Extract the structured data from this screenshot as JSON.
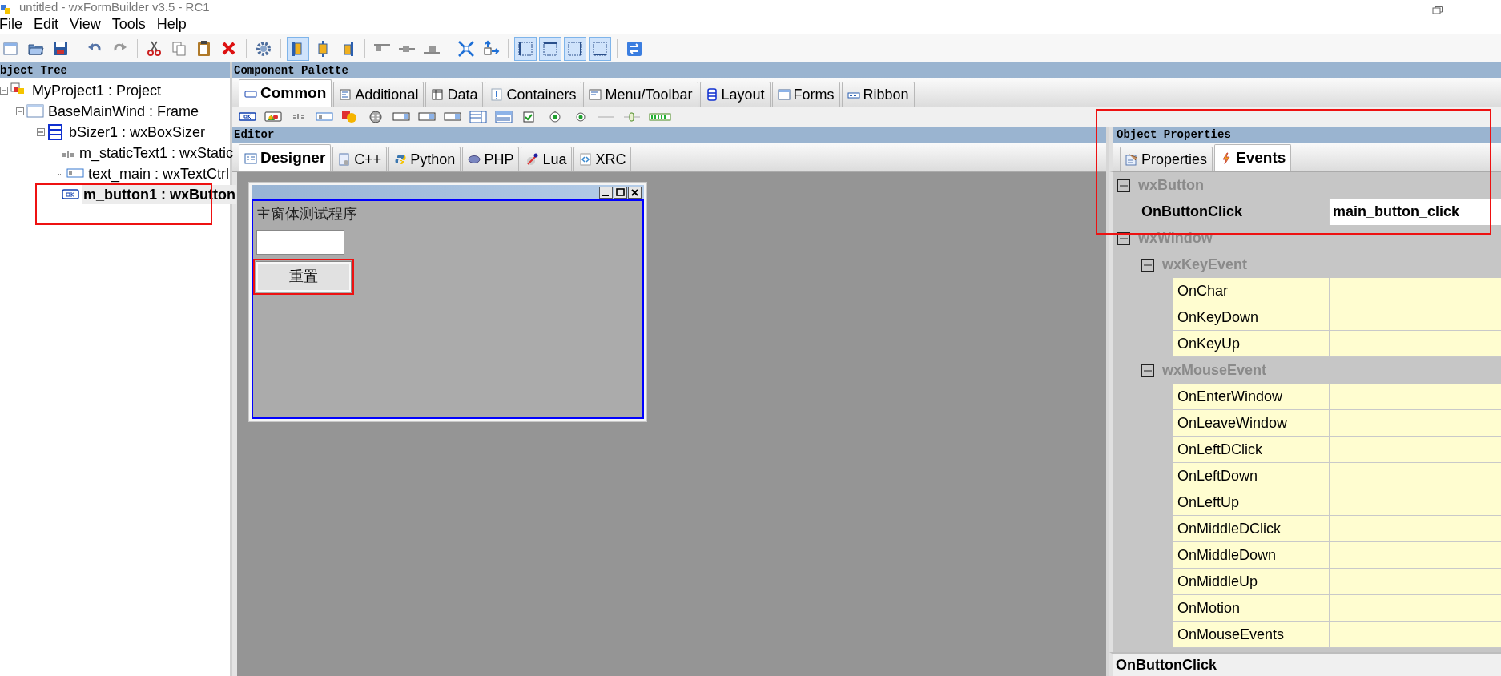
{
  "window": {
    "title": "untitled - wxFormBuilder v3.5 - RC1"
  },
  "menu": [
    "File",
    "Edit",
    "View",
    "Tools",
    "Help"
  ],
  "toolbar": [
    {
      "kind": "new",
      "pressed": false
    },
    {
      "kind": "open",
      "pressed": false
    },
    {
      "kind": "save",
      "pressed": false
    },
    {
      "kind": "separator"
    },
    {
      "kind": "undo",
      "pressed": false
    },
    {
      "kind": "redo",
      "pressed": false
    },
    {
      "kind": "separator"
    },
    {
      "kind": "cut",
      "pressed": false
    },
    {
      "kind": "copy",
      "pressed": false
    },
    {
      "kind": "paste",
      "pressed": false
    },
    {
      "kind": "delete",
      "pressed": false
    },
    {
      "kind": "separator"
    },
    {
      "kind": "settings",
      "pressed": false
    },
    {
      "kind": "separator"
    },
    {
      "kind": "align-left",
      "pressed": true
    },
    {
      "kind": "align-center",
      "pressed": false
    },
    {
      "kind": "align-right",
      "pressed": false
    },
    {
      "kind": "separator"
    },
    {
      "kind": "align-top",
      "pressed": false
    },
    {
      "kind": "align-middle",
      "pressed": false
    },
    {
      "kind": "align-bottom",
      "pressed": false
    },
    {
      "kind": "separator"
    },
    {
      "kind": "expand",
      "pressed": false
    },
    {
      "kind": "stretch",
      "pressed": false
    },
    {
      "kind": "separator"
    },
    {
      "kind": "border-left",
      "pressed": true
    },
    {
      "kind": "border-top",
      "pressed": true
    },
    {
      "kind": "border-right",
      "pressed": true
    },
    {
      "kind": "border-bottom",
      "pressed": true
    },
    {
      "kind": "separator"
    },
    {
      "kind": "swap",
      "pressed": false
    }
  ],
  "object_tree": {
    "title": "bject Tree",
    "items": [
      {
        "label": "MyProject1 : Project",
        "kind": "project",
        "selected": false,
        "expanded": true,
        "children": [
          {
            "label": "BaseMainWind : Frame",
            "kind": "frame",
            "selected": false,
            "expanded": true,
            "children": [
              {
                "label": "bSizer1 : wxBoxSizer",
                "kind": "sizer",
                "selected": false,
                "expanded": true,
                "children": [
                  {
                    "label": "m_staticText1 : wxStatic",
                    "kind": "statictext",
                    "selected": false,
                    "highlighted": false
                  },
                  {
                    "label": "text_main : wxTextCtrl",
                    "kind": "textctrl",
                    "selected": false,
                    "highlighted": false
                  },
                  {
                    "label": "m_button1 : wxButton",
                    "kind": "button",
                    "selected": true,
                    "highlighted": true
                  }
                ]
              }
            ]
          }
        ]
      }
    ]
  },
  "palette": {
    "title": "Component Palette",
    "tabs": [
      {
        "label": "Common",
        "selected": true
      },
      {
        "label": "Additional",
        "selected": false
      },
      {
        "label": "Data",
        "selected": false
      },
      {
        "label": "Containers",
        "selected": false
      },
      {
        "label": "Menu/Toolbar",
        "selected": false
      },
      {
        "label": "Layout",
        "selected": false
      },
      {
        "label": "Forms",
        "selected": false
      },
      {
        "label": "Ribbon",
        "selected": false
      }
    ]
  },
  "editor": {
    "title": "Editor",
    "tabs": [
      {
        "label": "Designer",
        "selected": true
      },
      {
        "label": "C++",
        "selected": false
      },
      {
        "label": "Python",
        "selected": false
      },
      {
        "label": "PHP",
        "selected": false
      },
      {
        "label": "Lua",
        "selected": false
      },
      {
        "label": "XRC",
        "selected": false
      }
    ],
    "form": {
      "static_text": "主窗体测试程序",
      "button": {
        "label": "重置",
        "highlighted": true
      }
    }
  },
  "properties": {
    "title": "Object Properties",
    "highlighted": true,
    "tabs": [
      {
        "label": "Properties",
        "selected": false
      },
      {
        "label": "Events",
        "selected": true
      }
    ],
    "groups": [
      {
        "name": "wxButton",
        "expanded": true,
        "rows": [
          {
            "name": "OnButtonClick",
            "value": "main_button_click",
            "modified": true
          }
        ]
      },
      {
        "name": "wxWindow",
        "expanded": true,
        "groups": [
          {
            "name": "wxKeyEvent",
            "expanded": true,
            "rows": [
              {
                "name": "OnChar",
                "modified": false
              },
              {
                "name": "OnKeyDown",
                "modified": false
              },
              {
                "name": "OnKeyUp",
                "modified": false
              }
            ]
          },
          {
            "name": "wxMouseEvent",
            "expanded": true,
            "rows": [
              {
                "name": "OnEnterWindow",
                "modified": false
              },
              {
                "name": "OnLeaveWindow",
                "modified": false
              },
              {
                "name": "OnLeftDClick",
                "modified": false
              },
              {
                "name": "OnLeftDown",
                "modified": false
              },
              {
                "name": "OnLeftUp",
                "modified": false
              },
              {
                "name": "OnMiddleDClick",
                "modified": false
              },
              {
                "name": "OnMiddleDown",
                "modified": false
              },
              {
                "name": "OnMiddleUp",
                "modified": false
              },
              {
                "name": "OnMotion",
                "modified": false
              },
              {
                "name": "OnMouseEvents",
                "modified": false
              }
            ]
          }
        ]
      }
    ],
    "description": "OnButtonClick"
  }
}
